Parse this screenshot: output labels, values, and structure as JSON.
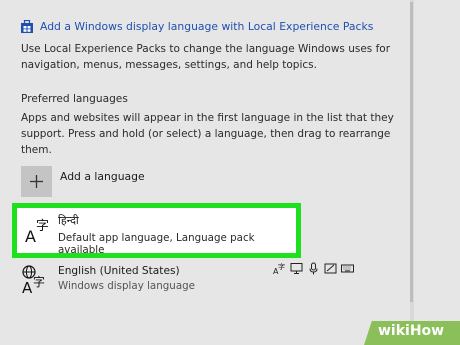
{
  "link": {
    "label": "Add a Windows display language with Local Experience Packs"
  },
  "description": "Use Local Experience Packs to change the language Windows uses for navigation, menus, messages, settings, and help topics.",
  "preferred": {
    "title": "Preferred languages",
    "description": "Apps and websites will appear in the first language in the list that they support. Press and hold (or select) a language, then drag to rearrange them.",
    "add_label": "Add a language"
  },
  "languages": [
    {
      "name": "हिन्दी",
      "detail": "Default app language, Language pack available",
      "highlighted": true,
      "icon": "language-icon"
    },
    {
      "name": "English (United States)",
      "detail": "Windows display language",
      "icon": "language-globe-icon",
      "feature_icons": [
        "language-pack-icon",
        "display-icon",
        "speech-icon",
        "handwriting-icon",
        "keyboard-icon"
      ]
    }
  ],
  "colors": {
    "link": "#1f4fb0",
    "highlight": "#1fe01f",
    "watermark": "#8bbf5a"
  },
  "watermark": {
    "text": "wikiHow"
  }
}
